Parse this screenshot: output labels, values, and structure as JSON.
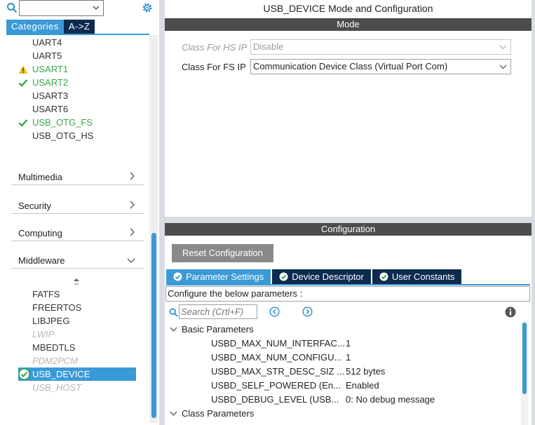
{
  "left": {
    "search": {
      "value": ""
    },
    "tabs": {
      "categories": "Categories",
      "az": "A->Z"
    },
    "peripherals": [
      {
        "label": "UART4",
        "status": "none"
      },
      {
        "label": "UART5",
        "status": "none"
      },
      {
        "label": "USART1",
        "status": "warning"
      },
      {
        "label": "USART2",
        "status": "ok"
      },
      {
        "label": "USART3",
        "status": "none"
      },
      {
        "label": "USART6",
        "status": "none"
      },
      {
        "label": "USB_OTG_FS",
        "status": "ok"
      },
      {
        "label": "USB_OTG_HS",
        "status": "none"
      }
    ],
    "sections": {
      "multimedia": "Multimedia",
      "security": "Security",
      "computing": "Computing",
      "middleware": "Middleware"
    },
    "middleware_items": [
      {
        "label": "FATFS",
        "state": "normal"
      },
      {
        "label": "FREERTOS",
        "state": "normal"
      },
      {
        "label": "LIBJPEG",
        "state": "normal"
      },
      {
        "label": "LWIP",
        "state": "disabled"
      },
      {
        "label": "MBEDTLS",
        "state": "normal"
      },
      {
        "label": "PDM2PCM",
        "state": "disabled"
      },
      {
        "label": "USB_DEVICE",
        "state": "selected"
      },
      {
        "label": "USB_HOST",
        "state": "disabled"
      }
    ]
  },
  "mode": {
    "title": "USB_DEVICE Mode and Configuration",
    "header": "Mode",
    "hs": {
      "label": "Class For HS IP",
      "value": "Disable"
    },
    "fs": {
      "label": "Class For FS IP",
      "value": "Communication Device Class (Virtual Port Com)"
    }
  },
  "config": {
    "header": "Configuration",
    "reset_label": "Reset Configuration",
    "tabs": {
      "params": "Parameter Settings",
      "device": "Device Descriptor",
      "user": "User Constants"
    },
    "hint": "Configure the below parameters :",
    "search_placeholder": "Search (Crtl+F)",
    "groups": {
      "basic": "Basic Parameters",
      "class": "Class Parameters"
    },
    "params": [
      {
        "name": "USBD_MAX_NUM_INTERFAC...",
        "value": "1"
      },
      {
        "name": "USBD_MAX_NUM_CONFIGU...",
        "value": "1"
      },
      {
        "name": "USBD_MAX_STR_DESC_SIZ ...",
        "value": "512 bytes"
      },
      {
        "name": "USBD_SELF_POWERED (En...",
        "value": "Enabled"
      },
      {
        "name": "USBD_DEBUG_LEVEL (USB...",
        "value": "0: No debug message"
      }
    ]
  },
  "colors": {
    "accent": "#3a9ad6",
    "navy": "#0d2b4e",
    "ok": "#35a845",
    "warning": "#f0c419",
    "bar": "#4d4d4d"
  }
}
